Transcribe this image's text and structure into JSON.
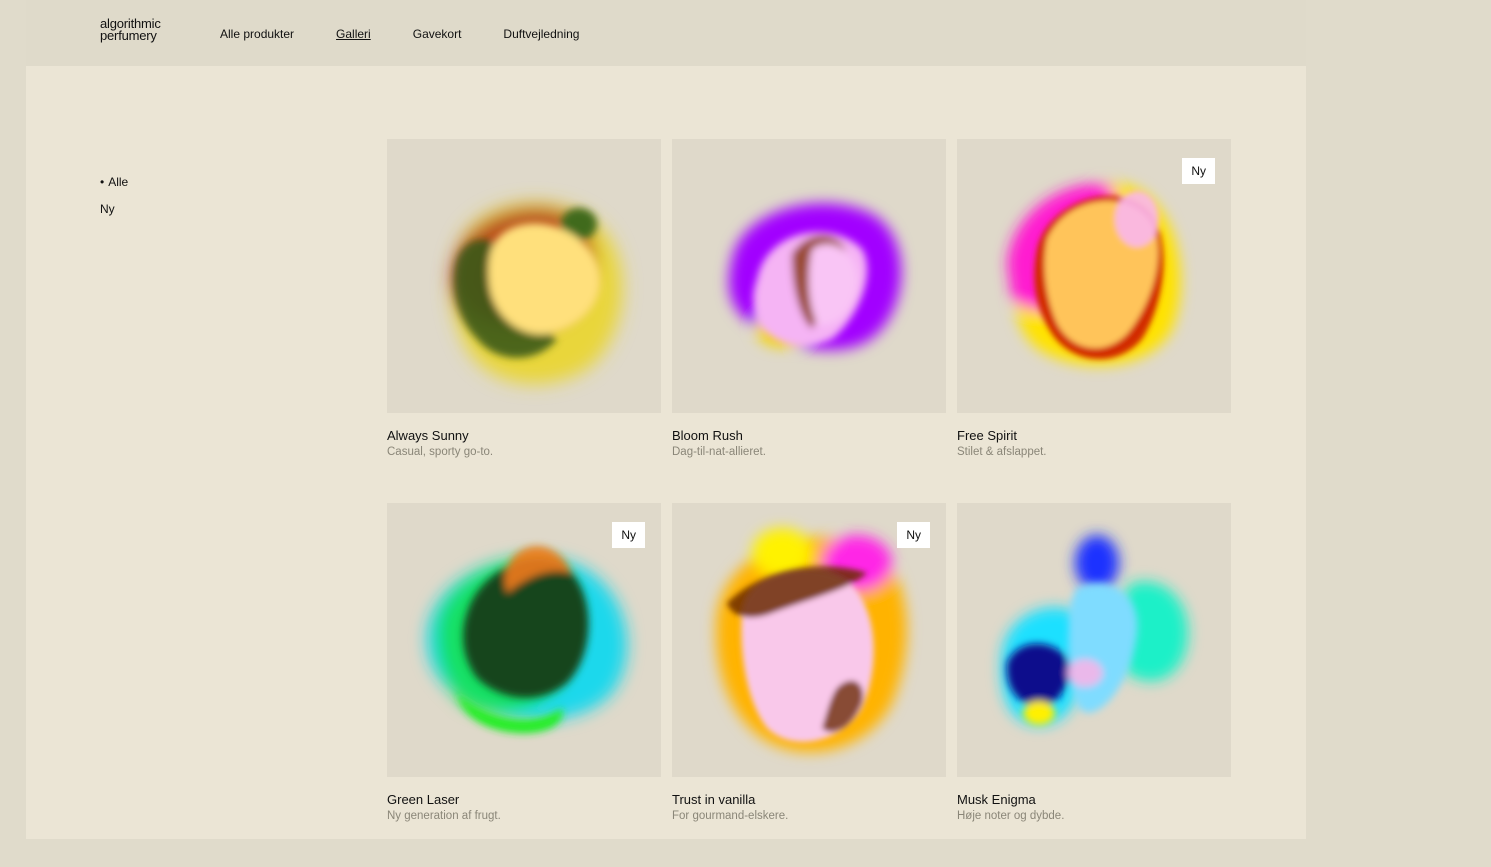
{
  "brand": {
    "line1": "algorithmic",
    "line2": "perfumery"
  },
  "nav": {
    "items": [
      "Alle produkter",
      "Galleri",
      "Gavekort",
      "Duftvejledning"
    ],
    "active": "Galleri"
  },
  "filters": [
    {
      "label": "Alle",
      "selected": true,
      "bullet": "•"
    },
    {
      "label": "Ny",
      "selected": false
    }
  ],
  "products": [
    {
      "name": "Always Sunny",
      "desc": "Casual, sporty go-to.",
      "badge": "",
      "art": "sunny-blob-icon"
    },
    {
      "name": "Bloom Rush",
      "desc": "Dag-til-nat-allieret.",
      "badge": "",
      "art": "bloom-blob-icon"
    },
    {
      "name": "Free Spirit",
      "desc": "Stilet & afslappet.",
      "badge": "Ny",
      "art": "spirit-blob-icon"
    },
    {
      "name": "Green Laser",
      "desc": "Ny generation af frugt.",
      "badge": "Ny",
      "art": "laser-blob-icon"
    },
    {
      "name": "Trust in vanilla",
      "desc": "For gourmand-elskere.",
      "badge": "Ny",
      "art": "vanilla-blob-icon"
    },
    {
      "name": "Musk Enigma",
      "desc": "Høje noter og dybde.",
      "badge": "",
      "art": "musk-blob-icon"
    }
  ]
}
